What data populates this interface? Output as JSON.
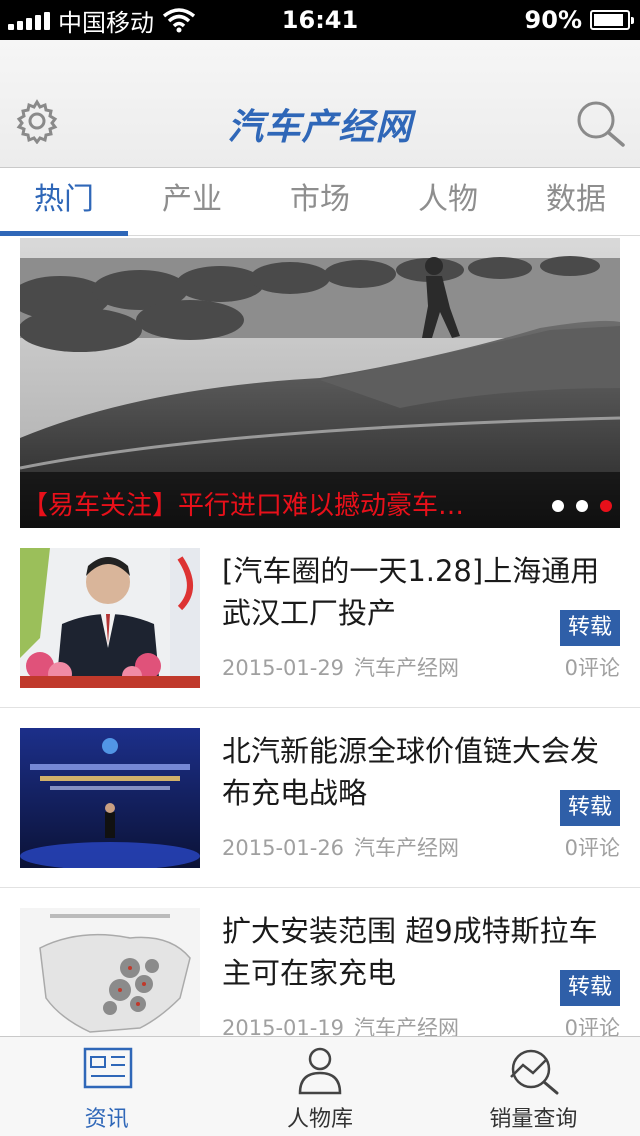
{
  "status_bar": {
    "carrier": "中国移动",
    "time": "16:41",
    "battery": "90%",
    "battery_level": 0.9
  },
  "header": {
    "brand": "汽车产经网",
    "settings_icon": "gear-icon",
    "search_icon": "search-icon"
  },
  "tabs": [
    {
      "label": "热门",
      "active": true
    },
    {
      "label": "产业",
      "active": false
    },
    {
      "label": "市场",
      "active": false
    },
    {
      "label": "人物",
      "active": false
    },
    {
      "label": "数据",
      "active": false
    }
  ],
  "hero": {
    "caption": "【易车关注】平行进口难以撼动豪车…",
    "slide_count": 3,
    "active_slide": 3
  },
  "articles": [
    {
      "title": "[汽车圈的一天1.28]上海通用武汉工厂投产",
      "date": "2015-01-29",
      "source": "汽车产经网",
      "tag": "转载",
      "comments": "0评论"
    },
    {
      "title": "北汽新能源全球价值链大会发布充电战略",
      "date": "2015-01-26",
      "source": "汽车产经网",
      "tag": "转载",
      "comments": "0评论"
    },
    {
      "title": "扩大安装范围 超9成特斯拉车主可在家充电",
      "date": "2015-01-19",
      "source": "汽车产经网",
      "tag": "转载",
      "comments": "0评论"
    }
  ],
  "tab_bar": [
    {
      "label": "资讯",
      "icon": "news-icon",
      "active": true
    },
    {
      "label": "人物库",
      "icon": "person-icon",
      "active": false
    },
    {
      "label": "销量查询",
      "icon": "sales-chart-icon",
      "active": false
    }
  ],
  "colors": {
    "accent": "#2f67b8",
    "tag_bg": "#2f5fa8",
    "caption_red": "#e8101a"
  }
}
